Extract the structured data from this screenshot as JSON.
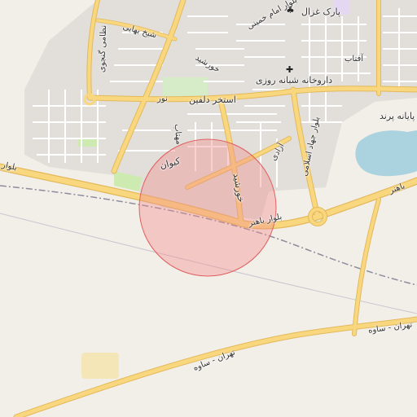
{
  "map": {
    "highlight_circle": {
      "fill": "#f28b8b",
      "stroke": "#e06060",
      "opacity": 0.4
    },
    "colors": {
      "land": "#f2efe9",
      "water": "#aad3df",
      "primary_road": "#f9d77e",
      "primary_casing": "#e3b95c",
      "residential": "#e2dfda",
      "park": "#cdebb0",
      "railway": "#8c8c9c"
    },
    "labels": {
      "park_ghazal": "پارک غزال",
      "imam_khomeini": "بلوار امام خمینی",
      "sheikh_bahaei": "شیخ بهایی",
      "nezami_ganjavi": "نظامی گنجوی",
      "khorshid_top": "خورشید",
      "pharmacy": "داروخانه شبانه روزی",
      "aftab": "آفتاب",
      "pool": "استخر دلفین",
      "noor": "نور",
      "jahad_islami": "بلوار جهاد اسلامی",
      "parand_terminal": "پایانه پرند",
      "azadi": "آزادی",
      "mahtab": "مهتاب",
      "keyvan": "کیوان",
      "khorshid": "خورشید",
      "bahar_top": "بلوار",
      "bahar_bottom": "بلوار باهنر",
      "bahar_right": "باهنر",
      "tehran_saveh_1": "تهران - ساوه",
      "tehran_saveh_2": "تهران - ساوه"
    },
    "icons": [
      "pharmacy-icon",
      "park-icon"
    ]
  }
}
